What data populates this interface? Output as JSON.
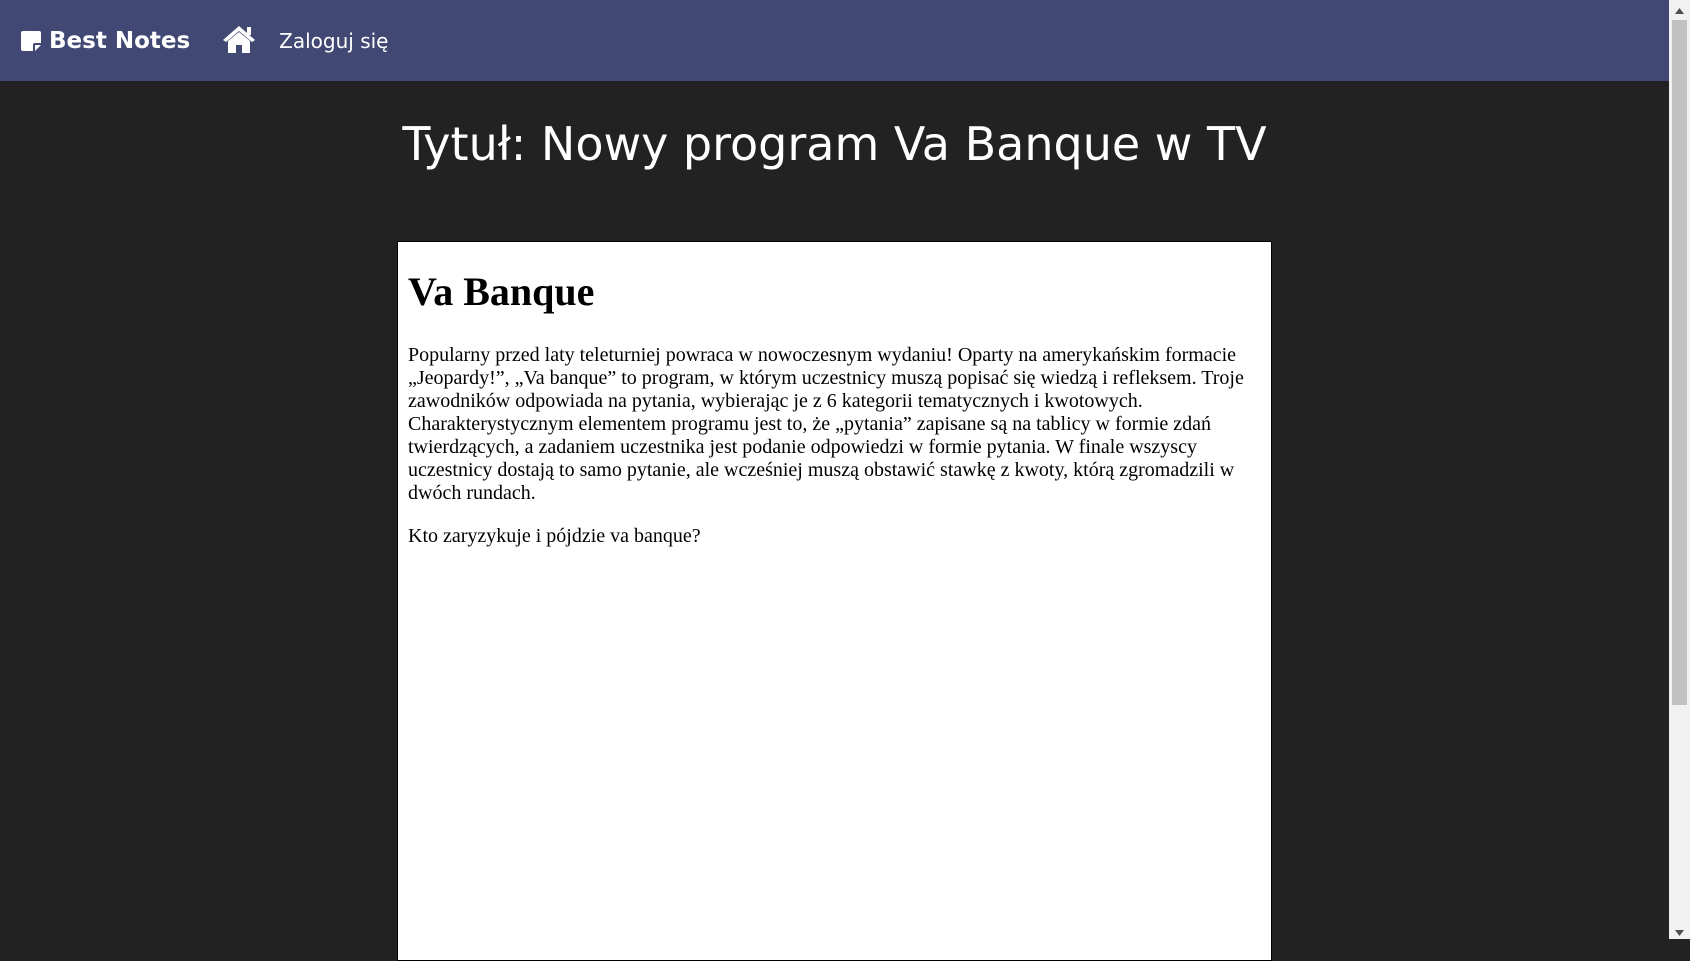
{
  "navbar": {
    "brand_label": "Best Notes",
    "brand_icon": "sticky-note-icon",
    "home_icon": "home-icon",
    "login_label": "Zaloguj się",
    "background_color": "#424874"
  },
  "page": {
    "title": "Tytuł: Nowy program Va Banque w TV",
    "background_color": "#222222"
  },
  "note": {
    "heading": "Va Banque",
    "paragraphs": [
      "Popularny przed laty teleturniej powraca w nowoczesnym wydaniu! Oparty na amerykańskim formacie „Jeopardy!”, „Va banque” to program, w którym uczestnicy muszą popisać się wiedzą i refleksem. Troje zawodników odpowiada na pytania, wybierając je z 6 kategorii tematycznych i kwotowych. Charakterystycznym elementem programu jest to, że „pytania” zapisane są na tablicy w formie zdań twierdzących, a zadaniem uczestnika jest podanie odpowiedzi w formie pytania. W finale wszyscy uczestnicy dostają to samo pytanie, ale wcześniej muszą obstawić stawkę z kwoty, którą zgromadzili w dwóch rundach.",
      "Kto zaryzykuje i pójdzie va banque?"
    ]
  },
  "scrollbar": {
    "up_icon": "scroll-up-arrow-icon",
    "down_icon": "scroll-down-arrow-icon"
  }
}
